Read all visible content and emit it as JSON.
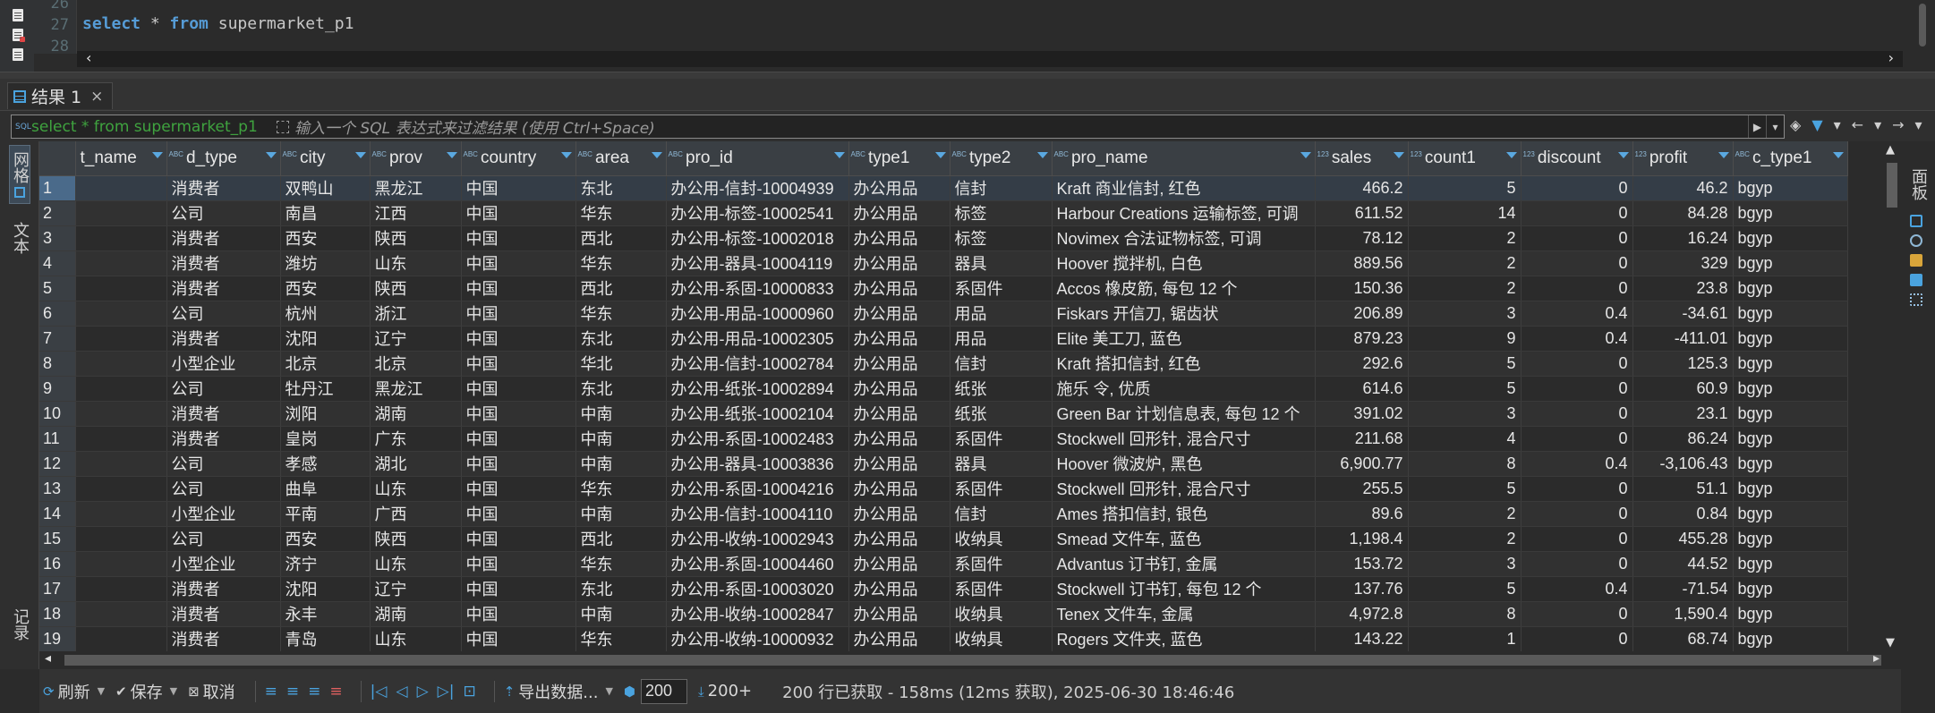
{
  "editor": {
    "line_numbers": [
      "26",
      "27",
      "28"
    ],
    "code_keyword_select": "select",
    "code_star": " * ",
    "code_keyword_from": "from",
    "code_table": " supermarket_p1"
  },
  "results": {
    "tab_label": "结果 1",
    "filter": {
      "last_query": "select * from supermarket_p1",
      "placeholder": "输入一个 SQL 表达式来过滤结果 (使用 Ctrl+Space)"
    }
  },
  "left_panel": {
    "grid_tab": "网格",
    "text_tab": "文本",
    "record_tab": "记录"
  },
  "right_panel": {
    "label": "面板"
  },
  "grid": {
    "columns": [
      {
        "type": "",
        "name": "t_name"
      },
      {
        "type": "ABC",
        "name": "d_type"
      },
      {
        "type": "ABC",
        "name": "city"
      },
      {
        "type": "ABC",
        "name": "prov"
      },
      {
        "type": "ABC",
        "name": "country"
      },
      {
        "type": "ABC",
        "name": "area"
      },
      {
        "type": "ABC",
        "name": "pro_id"
      },
      {
        "type": "ABC",
        "name": "type1"
      },
      {
        "type": "ABC",
        "name": "type2"
      },
      {
        "type": "ABC",
        "name": "pro_name"
      },
      {
        "type": "123",
        "name": "sales"
      },
      {
        "type": "123",
        "name": "count1"
      },
      {
        "type": "123",
        "name": "discount"
      },
      {
        "type": "123",
        "name": "profit"
      },
      {
        "type": "ABC",
        "name": "c_type1"
      }
    ],
    "rows": [
      [
        "1",
        "",
        "消费者",
        "双鸭山",
        "黑龙江",
        "中国",
        "东北",
        "办公用-信封-10004939",
        "办公用品",
        "信封",
        "Kraft 商业信封, 红色",
        "466.2",
        "5",
        "0",
        "46.2",
        "bgyp"
      ],
      [
        "2",
        "",
        "公司",
        "南昌",
        "江西",
        "中国",
        "华东",
        "办公用-标签-10002541",
        "办公用品",
        "标签",
        "Harbour Creations 运输标签, 可调",
        "611.52",
        "14",
        "0",
        "84.28",
        "bgyp"
      ],
      [
        "3",
        "",
        "消费者",
        "西安",
        "陕西",
        "中国",
        "西北",
        "办公用-标签-10002018",
        "办公用品",
        "标签",
        "Novimex 合法证物标签, 可调",
        "78.12",
        "2",
        "0",
        "16.24",
        "bgyp"
      ],
      [
        "4",
        "",
        "消费者",
        "潍坊",
        "山东",
        "中国",
        "华东",
        "办公用-器具-10004119",
        "办公用品",
        "器具",
        "Hoover 搅拌机, 白色",
        "889.56",
        "2",
        "0",
        "329",
        "bgyp"
      ],
      [
        "5",
        "",
        "消费者",
        "西安",
        "陕西",
        "中国",
        "西北",
        "办公用-系固-10000833",
        "办公用品",
        "系固件",
        "Accos 橡皮筋, 每包 12 个",
        "150.36",
        "2",
        "0",
        "23.8",
        "bgyp"
      ],
      [
        "6",
        "",
        "公司",
        "杭州",
        "浙江",
        "中国",
        "华东",
        "办公用-用品-10000960",
        "办公用品",
        "用品",
        "Fiskars 开信刀, 锯齿状",
        "206.89",
        "3",
        "0.4",
        "-34.61",
        "bgyp"
      ],
      [
        "7",
        "",
        "消费者",
        "沈阳",
        "辽宁",
        "中国",
        "东北",
        "办公用-用品-10002305",
        "办公用品",
        "用品",
        "Elite 美工刀, 蓝色",
        "879.23",
        "9",
        "0.4",
        "-411.01",
        "bgyp"
      ],
      [
        "8",
        "",
        "小型企业",
        "北京",
        "北京",
        "中国",
        "华北",
        "办公用-信封-10002784",
        "办公用品",
        "信封",
        "Kraft 搭扣信封, 红色",
        "292.6",
        "5",
        "0",
        "125.3",
        "bgyp"
      ],
      [
        "9",
        "",
        "公司",
        "牡丹江",
        "黑龙江",
        "中国",
        "东北",
        "办公用-纸张-10002894",
        "办公用品",
        "纸张",
        "施乐 令, 优质",
        "614.6",
        "5",
        "0",
        "60.9",
        "bgyp"
      ],
      [
        "10",
        "",
        "消费者",
        "浏阳",
        "湖南",
        "中国",
        "中南",
        "办公用-纸张-10002104",
        "办公用品",
        "纸张",
        "Green Bar 计划信息表, 每包 12 个",
        "391.02",
        "3",
        "0",
        "23.1",
        "bgyp"
      ],
      [
        "11",
        "",
        "消费者",
        "皇岗",
        "广东",
        "中国",
        "中南",
        "办公用-系固-10002483",
        "办公用品",
        "系固件",
        "Stockwell 回形针, 混合尺寸",
        "211.68",
        "4",
        "0",
        "86.24",
        "bgyp"
      ],
      [
        "12",
        "",
        "公司",
        "孝感",
        "湖北",
        "中国",
        "中南",
        "办公用-器具-10003836",
        "办公用品",
        "器具",
        "Hoover 微波炉, 黑色",
        "6,900.77",
        "8",
        "0.4",
        "-3,106.43",
        "bgyp"
      ],
      [
        "13",
        "",
        "公司",
        "曲阜",
        "山东",
        "中国",
        "华东",
        "办公用-系固-10004216",
        "办公用品",
        "系固件",
        "Stockwell 回形针, 混合尺寸",
        "255.5",
        "5",
        "0",
        "51.1",
        "bgyp"
      ],
      [
        "14",
        "",
        "小型企业",
        "平南",
        "广西",
        "中国",
        "中南",
        "办公用-信封-10004110",
        "办公用品",
        "信封",
        "Ames 搭扣信封, 银色",
        "89.6",
        "2",
        "0",
        "0.84",
        "bgyp"
      ],
      [
        "15",
        "",
        "公司",
        "西安",
        "陕西",
        "中国",
        "西北",
        "办公用-收纳-10002943",
        "办公用品",
        "收纳具",
        "Smead 文件车, 蓝色",
        "1,198.4",
        "2",
        "0",
        "455.28",
        "bgyp"
      ],
      [
        "16",
        "",
        "小型企业",
        "济宁",
        "山东",
        "中国",
        "华东",
        "办公用-系固-10004460",
        "办公用品",
        "系固件",
        "Advantus 订书钉, 金属",
        "153.72",
        "3",
        "0",
        "44.52",
        "bgyp"
      ],
      [
        "17",
        "",
        "消费者",
        "沈阳",
        "辽宁",
        "中国",
        "东北",
        "办公用-系固-10003020",
        "办公用品",
        "系固件",
        "Stockwell 订书钉, 每包 12 个",
        "137.76",
        "5",
        "0.4",
        "-71.54",
        "bgyp"
      ],
      [
        "18",
        "",
        "消费者",
        "永丰",
        "湖南",
        "中国",
        "中南",
        "办公用-收纳-10002847",
        "办公用品",
        "收纳具",
        "Tenex 文件车, 金属",
        "4,972.8",
        "8",
        "0",
        "1,590.4",
        "bgyp"
      ],
      [
        "19",
        "",
        "消费者",
        "青岛",
        "山东",
        "中国",
        "华东",
        "办公用-收纳-10000932",
        "办公用品",
        "收纳具",
        "Rogers 文件夹, 蓝色",
        "143.22",
        "1",
        "0",
        "68.74",
        "bgyp"
      ]
    ]
  },
  "status": {
    "refresh": "刷新",
    "save": "保存",
    "cancel": "取消",
    "export": "导出数据...",
    "fetch_size": "200",
    "fetch_all": "200+",
    "text": "200 行已获取 - 158ms (12ms 获取), 2025-06-30 18:46:46"
  }
}
